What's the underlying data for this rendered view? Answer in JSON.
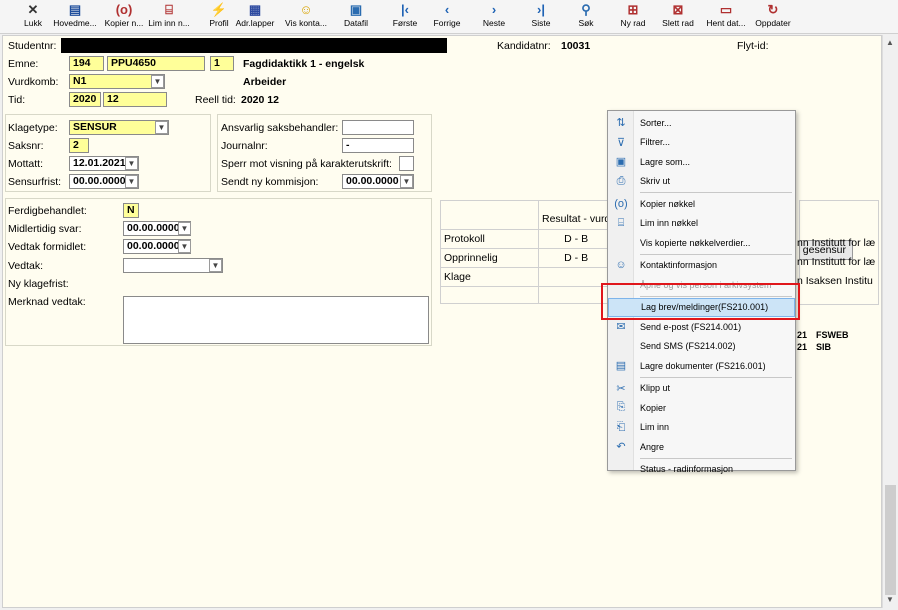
{
  "toolbar": {
    "buttons": [
      {
        "id": "lukk",
        "label": "Lukk",
        "icon": "close-icon",
        "glyph": "✕"
      },
      {
        "id": "hovedmeny",
        "label": "Hovedme...",
        "icon": "menu-icon",
        "glyph": "▤"
      },
      {
        "id": "kopier",
        "label": "Kopier n...",
        "icon": "copy-key-icon",
        "glyph": "(o)"
      },
      {
        "id": "lim",
        "label": "Lim inn n...",
        "icon": "paste-key-icon",
        "glyph": "⌸"
      },
      {
        "id": "profil",
        "label": "Profil",
        "icon": "lightning-icon",
        "glyph": "⚡"
      },
      {
        "id": "adrlapper",
        "label": "Adr.lapper",
        "icon": "grid-icon",
        "glyph": "▦"
      },
      {
        "id": "viskonta",
        "label": "Vis konta...",
        "icon": "person-icon",
        "glyph": "☺"
      },
      {
        "id": "datafil",
        "label": "Datafil",
        "icon": "save-icon",
        "glyph": "▣"
      },
      {
        "id": "forste",
        "label": "Første",
        "icon": "first-icon",
        "glyph": "|‹"
      },
      {
        "id": "forrige",
        "label": "Forrige",
        "icon": "prev-icon",
        "glyph": "‹"
      },
      {
        "id": "neste",
        "label": "Neste",
        "icon": "next-icon",
        "glyph": "›"
      },
      {
        "id": "siste",
        "label": "Siste",
        "icon": "last-icon",
        "glyph": "›|"
      },
      {
        "id": "sok",
        "label": "Søk",
        "icon": "search-icon",
        "glyph": "⚲"
      },
      {
        "id": "nyrad",
        "label": "Ny rad",
        "icon": "new-row-icon",
        "glyph": "⊞"
      },
      {
        "id": "slettrad",
        "label": "Slett rad",
        "icon": "delete-row-icon",
        "glyph": "⊠"
      },
      {
        "id": "hentdat",
        "label": "Hent dat...",
        "icon": "fetch-icon",
        "glyph": "▭"
      },
      {
        "id": "oppdater",
        "label": "Oppdater",
        "icon": "refresh-icon",
        "glyph": "↻"
      }
    ]
  },
  "form": {
    "studentnr_label": "Studentnr:",
    "kandidatnr_label": "Kandidatnr:",
    "kandidatnr": "10031",
    "flytid_label": "Flyt-id:",
    "emne_label": "Emne:",
    "emne_kode1": "194",
    "emne_kode2": "PPU4650",
    "emne_versjon": "1",
    "emne_navn": "Fagdidaktikk 1 - engelsk",
    "vurdkomb_label": "Vurdkomb:",
    "vurdkomb": "N1",
    "vurdkomb_navn": "Arbeider",
    "tid_label": "Tid:",
    "tid_ar": "2020",
    "tid_termin": "12",
    "reell_tid_label": "Reell tid:",
    "reell_tid": "2020   12",
    "klagetype_label": "Klagetype:",
    "klagetype": "SENSUR",
    "saksnr_label": "Saksnr:",
    "saksnr": "2",
    "mottatt_label": "Mottatt:",
    "mottatt": "12.01.2021",
    "sensurfrist_label": "Sensurfrist:",
    "sensurfrist": "00.00.0000",
    "ansvarlig_label": "Ansvarlig saksbehandler:",
    "journalnr_label": "Journalnr:",
    "journalnr": "-",
    "sperr_label": "Sperr mot visning på karakterutskrift:",
    "sendt_label": "Sendt ny kommisjon:",
    "sendt": "00.00.0000",
    "ferdig_label": "Ferdigbehandlet:",
    "ferdig": "N",
    "midl_label": "Midlertidig svar:",
    "midl": "00.00.0000",
    "vedtakform_label": "Vedtak formidlet:",
    "vedtakform": "00.00.0000",
    "vedtak_label": "Vedtak:",
    "klagefrist_label": "Ny klagefrist:",
    "merknad_label": "Merknad vedtak:"
  },
  "results": {
    "header": "Resultat - vurd",
    "rows": [
      {
        "name": "Protokoll",
        "grade": "D - B"
      },
      {
        "name": "Opprinnelig",
        "grade": "D - B"
      },
      {
        "name": "Klage",
        "grade": ""
      }
    ],
    "ges_button": "gesensur",
    "institutes": [
      "nn Institutt for læ",
      "nn Institutt for læ",
      "n Isaksen Institu"
    ],
    "log": [
      {
        "n": "21",
        "src": "FSWEB"
      },
      {
        "n": "21",
        "src": "SIB"
      }
    ]
  },
  "context_menu": {
    "items": [
      {
        "label": "Sorter...",
        "icon": "sort-icon",
        "glyph": "⇅",
        "disabled": false,
        "hl": false
      },
      {
        "label": "Filtrer...",
        "icon": "filter-icon",
        "glyph": "⊽",
        "disabled": false,
        "hl": false
      },
      {
        "label": "Lagre som...",
        "icon": "save-as-icon",
        "glyph": "▣",
        "disabled": false,
        "hl": false
      },
      {
        "label": "Skriv ut",
        "icon": "print-icon",
        "glyph": "⎙",
        "disabled": false,
        "hl": false
      },
      {
        "sep": true
      },
      {
        "label": "Kopier nøkkel",
        "icon": "copy-key-icon",
        "glyph": "(o)",
        "disabled": false,
        "hl": false
      },
      {
        "label": "Lim inn nøkkel",
        "icon": "paste-key-icon",
        "glyph": "⌸",
        "disabled": false,
        "hl": false
      },
      {
        "label": "Vis kopierte nøkkelverdier...",
        "icon": "none",
        "glyph": "",
        "disabled": false,
        "hl": false
      },
      {
        "sep": true
      },
      {
        "label": "Kontaktinformasjon",
        "icon": "contact-icon",
        "glyph": "☺",
        "disabled": false,
        "hl": false
      },
      {
        "label": "Åpne og vis person i arkivsystem",
        "icon": "none",
        "glyph": "",
        "disabled": true,
        "hl": false
      },
      {
        "sep": true
      },
      {
        "label": "Lag brev/meldinger(FS210.001)",
        "icon": "none",
        "glyph": "",
        "disabled": false,
        "hl": true
      },
      {
        "label": "Send e-post (FS214.001)",
        "icon": "mail-icon",
        "glyph": "✉",
        "disabled": false,
        "hl": false
      },
      {
        "label": "Send SMS (FS214.002)",
        "icon": "none",
        "glyph": "",
        "disabled": false,
        "hl": false
      },
      {
        "label": "Lagre dokumenter (FS216.001)",
        "icon": "documents-icon",
        "glyph": "▤",
        "disabled": false,
        "hl": false
      },
      {
        "sep": true
      },
      {
        "label": "Klipp ut",
        "icon": "cut-icon",
        "glyph": "✂",
        "disabled": false,
        "hl": false
      },
      {
        "label": "Kopier",
        "icon": "copy-icon",
        "glyph": "⎘",
        "disabled": false,
        "hl": false
      },
      {
        "label": "Lim inn",
        "icon": "paste-icon",
        "glyph": "⎗",
        "disabled": false,
        "hl": false
      },
      {
        "label": "Angre",
        "icon": "undo-icon",
        "glyph": "↶",
        "disabled": false,
        "hl": false
      },
      {
        "sep": true
      },
      {
        "label": "Status - radinformasjon",
        "icon": "none",
        "glyph": "",
        "disabled": false,
        "hl": false
      }
    ]
  }
}
